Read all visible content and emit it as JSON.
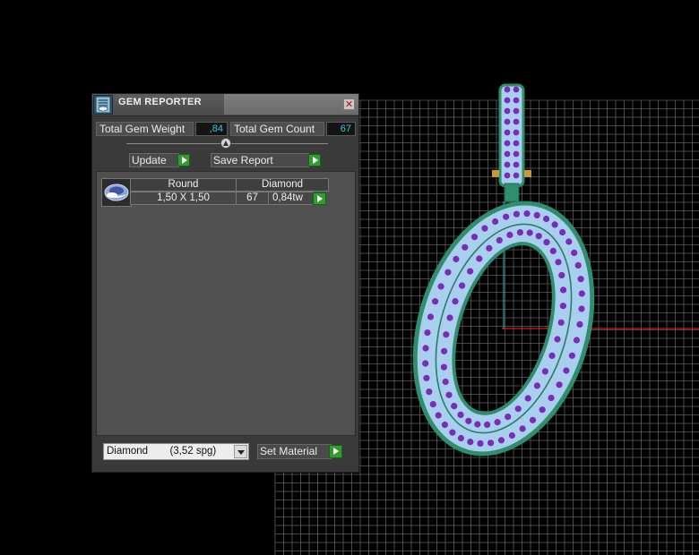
{
  "panel": {
    "title": "GEM REPORTER",
    "close_glyph": "✕",
    "icon": "gem-reporter-icon",
    "total_weight_label": "Total Gem Weight",
    "total_weight_value": ",84",
    "total_count_label": "Total Gem Count",
    "total_count_value": "67",
    "collapse_glyph": "▲",
    "update_label": "Update",
    "save_report_label": "Save Report",
    "table": {
      "headers": [
        "Round",
        "Diamond"
      ],
      "size": "1,50 X 1,50",
      "count": "67",
      "weight": "0,84tw"
    },
    "material_select": {
      "name": "Diamond",
      "spg": "(3,52 spg)"
    },
    "set_material_label": "Set Material"
  },
  "colors": {
    "panel_bg": "#3a3a3a",
    "value_text": "#39c7d8",
    "action_green": "#2f9d2f",
    "grid_line": "#5e5e5e",
    "axis_red": "#d21b1b",
    "axis_teal": "#1ea3a3",
    "ring_metal": "#2e8e6e",
    "gem_fill": "#a9cfee",
    "gem_dot": "#7a2bb8"
  }
}
